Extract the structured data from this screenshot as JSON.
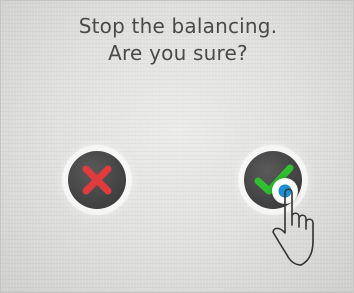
{
  "dialog": {
    "title_line1": "Stop the balancing.",
    "title_line2": "Are you sure?"
  },
  "buttons": {
    "cancel": {
      "icon": "close-icon",
      "color": "#e23b3b"
    },
    "confirm": {
      "icon": "check-icon",
      "color": "#2fbf2f"
    }
  },
  "overlay": {
    "pointer_icon": "hand-pointer-icon",
    "touch_icon": "touch-indicator-icon",
    "touch_color": "#1e8fd0"
  }
}
